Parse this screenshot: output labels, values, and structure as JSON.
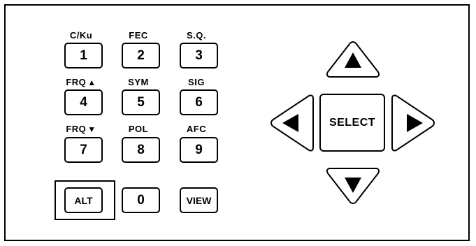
{
  "keypad": {
    "labels": {
      "l1": "C/Ku",
      "l2": "FEC",
      "l3": "S.Q.",
      "l4": "FRQ",
      "l5": "SYM",
      "l6": "SIG",
      "l7": "FRQ",
      "l8": "POL",
      "l9": "AFC"
    },
    "label_icons": {
      "l4": "up-triangle-icon",
      "l7": "down-triangle-icon"
    },
    "keys": {
      "k1": "1",
      "k2": "2",
      "k3": "3",
      "k4": "4",
      "k5": "5",
      "k6": "6",
      "k7": "7",
      "k8": "8",
      "k9": "9",
      "alt": "ALT",
      "k0": "0",
      "view": "VIEW"
    }
  },
  "navigation": {
    "select": "SELECT",
    "icons": {
      "up": "up-arrow-icon",
      "down": "down-arrow-icon",
      "left": "left-arrow-icon",
      "right": "right-arrow-icon"
    }
  },
  "colors": {
    "stroke": "#000000",
    "background": "#ffffff"
  }
}
